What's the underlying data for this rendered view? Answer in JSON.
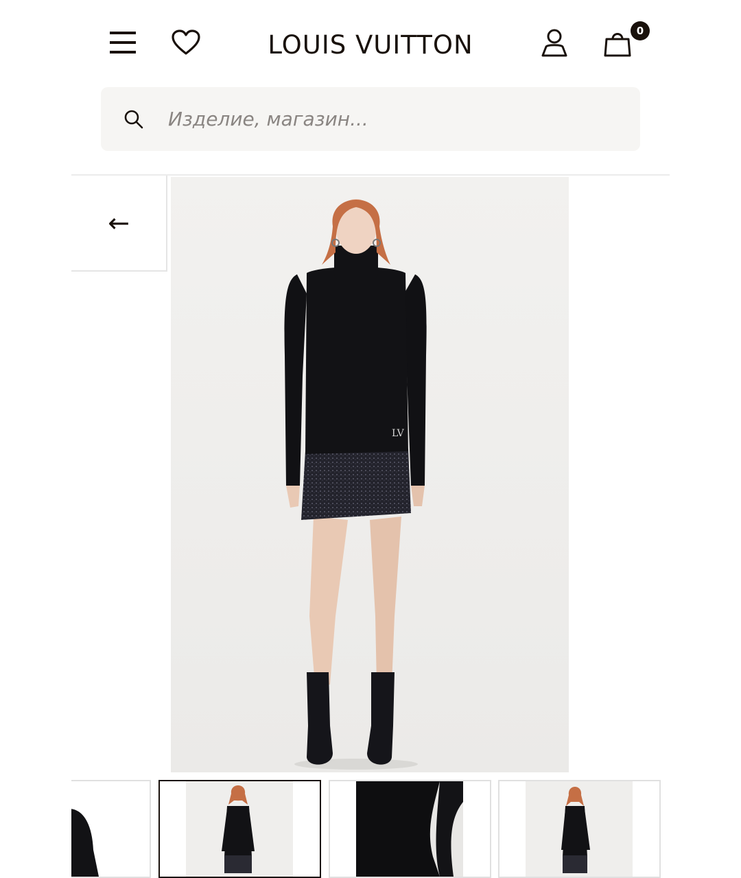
{
  "header": {
    "brand": "LOUIS VUITTON",
    "cart_count": "0",
    "icons": [
      "menu-icon",
      "heart-icon",
      "user-icon",
      "shopping-bag-icon"
    ]
  },
  "search": {
    "placeholder": "Изделие, магазин..."
  },
  "gallery": {
    "back_arrow": "←",
    "thumbnail_count": 4,
    "active_thumbnail": 2
  },
  "colors": {
    "text": "#19110b",
    "search_bg": "#f6f5f3",
    "image_bg": "#f0efed",
    "active_border": "#19110b"
  }
}
